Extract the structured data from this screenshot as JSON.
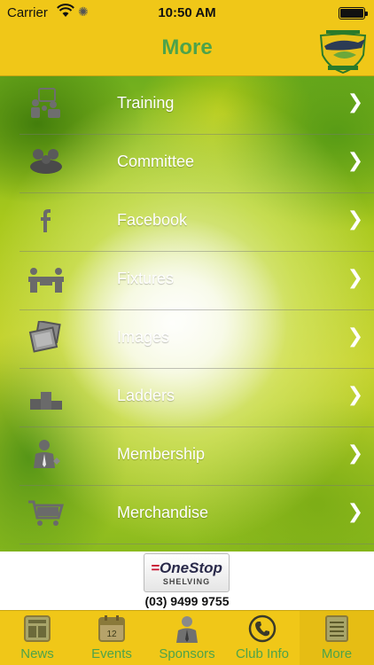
{
  "status": {
    "carrier": "Carrier",
    "time": "10:50 AM"
  },
  "nav": {
    "title": "More"
  },
  "menu": {
    "items": [
      {
        "label": "Training",
        "icon": "training-icon"
      },
      {
        "label": "Committee",
        "icon": "committee-icon"
      },
      {
        "label": "Facebook",
        "icon": "facebook-icon"
      },
      {
        "label": "Fixtures",
        "icon": "fixtures-icon"
      },
      {
        "label": "Images",
        "icon": "images-icon"
      },
      {
        "label": "Ladders",
        "icon": "ladders-icon"
      },
      {
        "label": "Membership",
        "icon": "membership-icon"
      },
      {
        "label": "Merchandise",
        "icon": "cart-icon"
      }
    ],
    "chevron": "❯"
  },
  "ad": {
    "brand_mark": "=",
    "brand": "OneStop",
    "sub": "SHELVING",
    "phone": "(03) 9499 9755"
  },
  "tabs": [
    {
      "label": "News",
      "icon": "newspaper-icon"
    },
    {
      "label": "Events",
      "icon": "calendar-icon",
      "day": "12"
    },
    {
      "label": "Sponsors",
      "icon": "sponsor-person-icon"
    },
    {
      "label": "Club Info",
      "icon": "phone-icon"
    },
    {
      "label": "More",
      "icon": "list-icon"
    }
  ],
  "colors": {
    "bar": "#f0c718",
    "accent_green": "#4ea34a",
    "label_white": "#ffffff"
  }
}
